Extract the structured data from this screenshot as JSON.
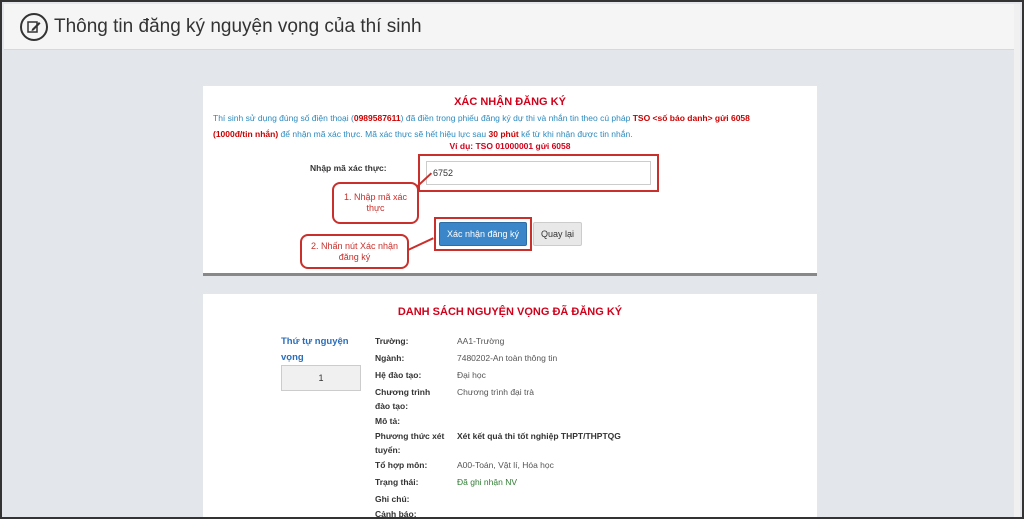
{
  "header": {
    "title": "Thông tin đăng ký nguyện vọng của thí sinh",
    "icon": "edit-icon"
  },
  "confirm": {
    "title": "XÁC NHẬN ĐĂNG KÝ",
    "info_prefix": "Thí sinh sử dụng đúng số điện thoại (",
    "phone": "0989587611",
    "info_middle": ") đã điền trong phiếu đăng ký dự thi và nhắn tin theo cú pháp ",
    "syntax": "TSO <số báo danh> gửi 6058",
    "fee": "(1000đ/tin nhắn)",
    "info_rest": " để nhận mã xác thực. Mã xác thực sẽ hết hiệu lực sau ",
    "validity": "30 phút",
    "info_end": " kể từ khi nhận được tin nhắn.",
    "example": "Ví dụ: TSO 01000001 gửi 6058",
    "code_label": "Nhập mã xác thực:",
    "code_value": "6752",
    "confirm_button": "Xác nhận đăng ký",
    "back_button": "Quay lại"
  },
  "callouts": {
    "step1": "1. Nhập mã xác thực",
    "step2": "2. Nhấn nút Xác nhận đăng ký"
  },
  "list": {
    "title": "DANH SÁCH NGUYỆN VỌNG ĐÃ ĐĂNG KÝ",
    "order_label": "Thứ tự nguyện vọng",
    "order_value": "1",
    "rows": [
      {
        "label": "Trường:",
        "value": "AA1-Trường"
      },
      {
        "label": "Ngành:",
        "value": "7480202-An toàn thông tin"
      },
      {
        "label": "Hệ đào tạo:",
        "value": "Đại học"
      },
      {
        "label": "Chương trình đào tạo:",
        "value": "Chương trình đại trà"
      },
      {
        "label": "Mô tả:",
        "value": ""
      },
      {
        "label": "Phương thức xét tuyển:",
        "value": "Xét kết quả thi tốt nghiệp THPT/THPTQG"
      },
      {
        "label": "Tổ hợp môn:",
        "value": "A00-Toán, Vật lí, Hóa học"
      },
      {
        "label": "Trạng thái:",
        "value": "Đã ghi nhận NV"
      },
      {
        "label": "Ghi chú:",
        "value": ""
      },
      {
        "label": "Cảnh báo:",
        "value": ""
      }
    ]
  },
  "colors": {
    "accent_red": "#d0021b",
    "button_blue": "#3a86c8",
    "link_blue": "#2a8abf",
    "status_green": "#2e7d32"
  }
}
